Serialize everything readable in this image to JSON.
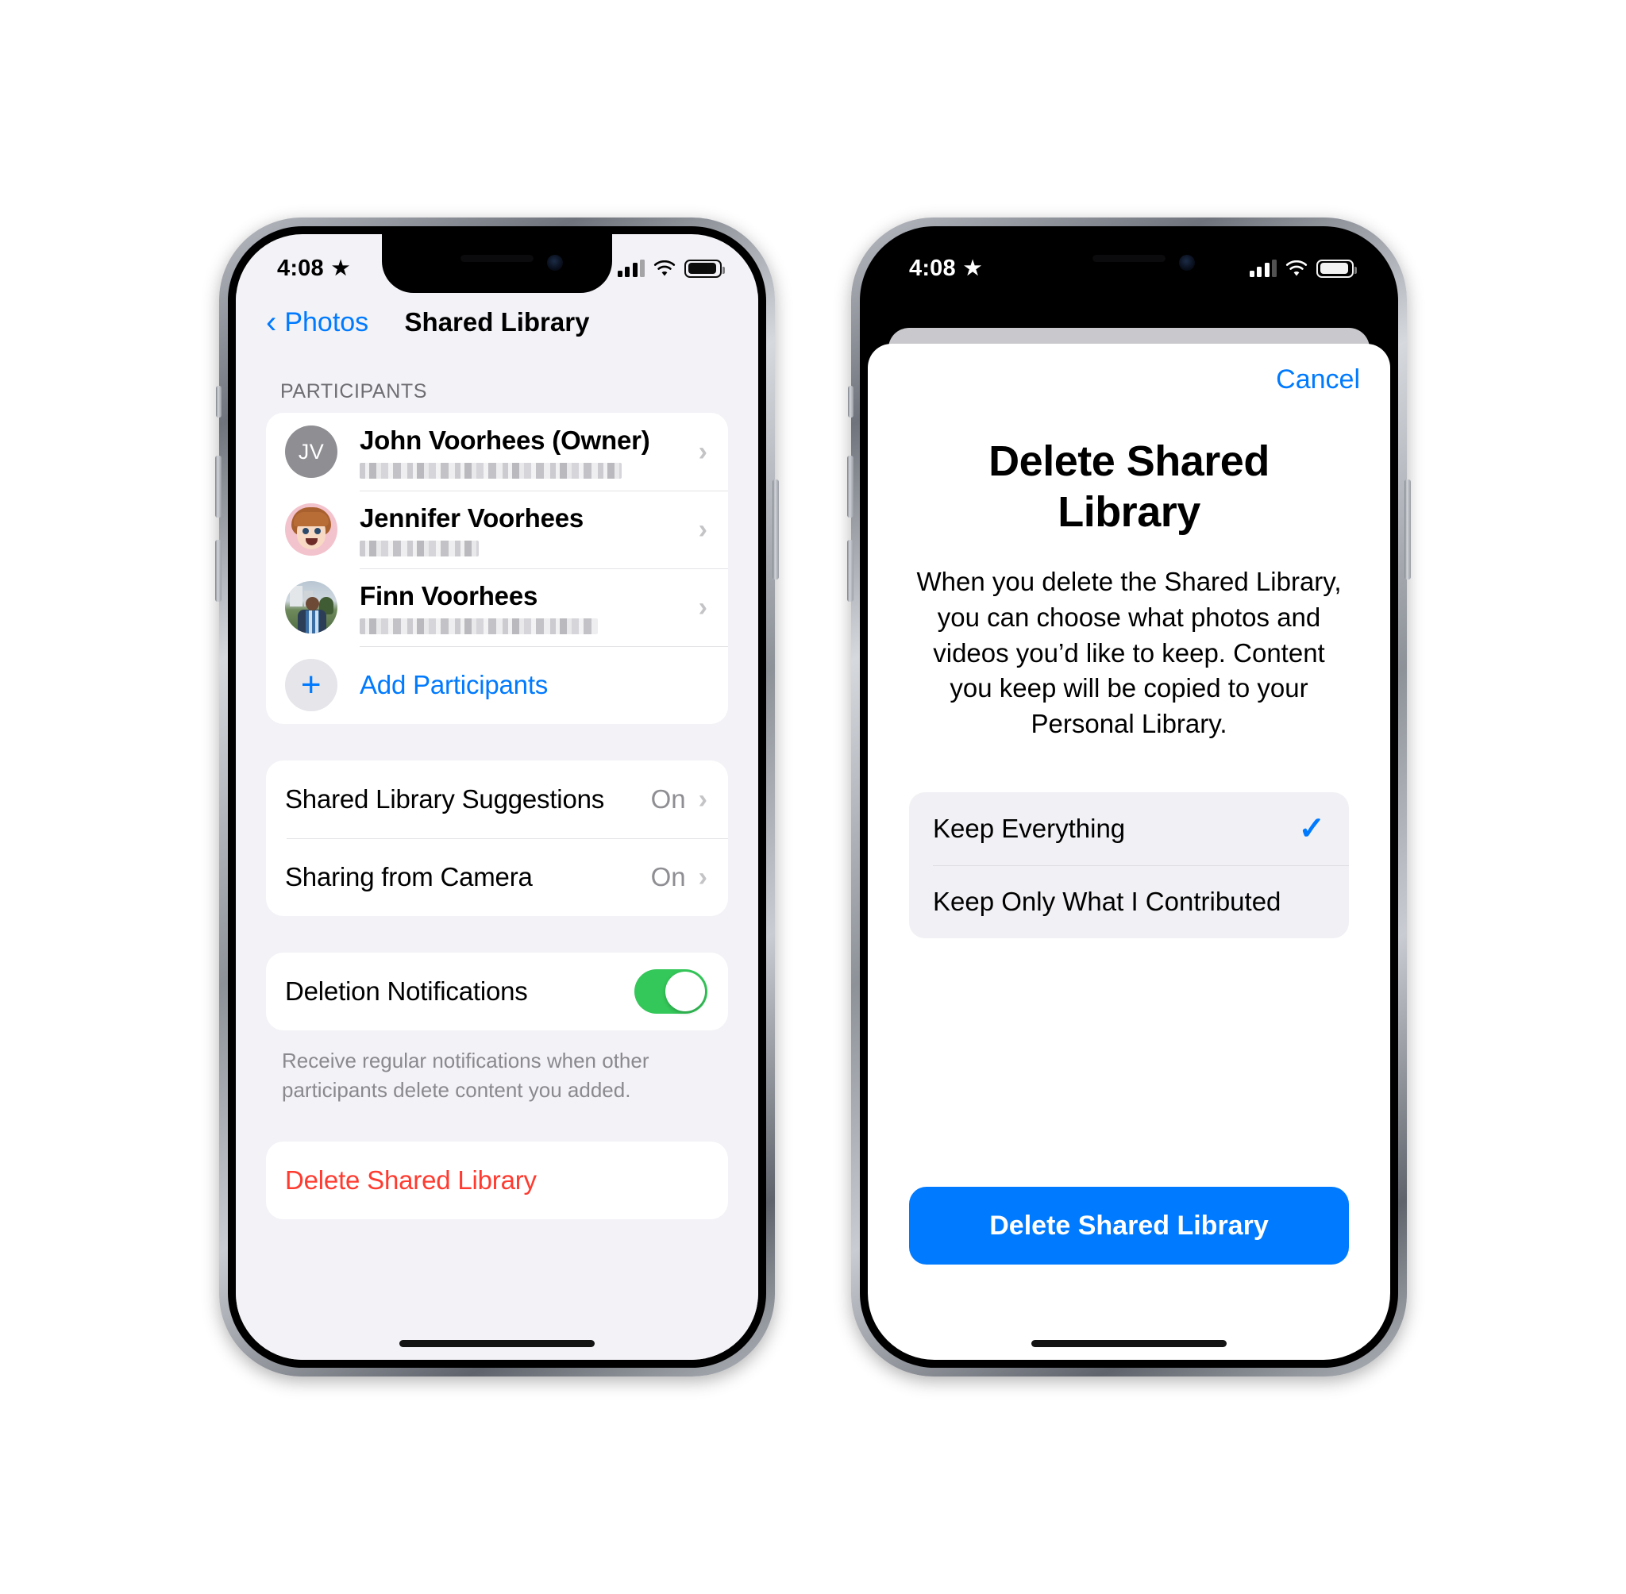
{
  "left_phone": {
    "status_bar": {
      "time": "4:08",
      "star_icon": "star-icon",
      "cellular_icon": "cellular-bars-icon",
      "wifi_icon": "wifi-icon",
      "battery_icon": "battery-icon"
    },
    "nav": {
      "back_label": "Photos",
      "title": "Shared Library"
    },
    "participants": {
      "header": "PARTICIPANTS",
      "items": [
        {
          "name": "John Voorhees (Owner)",
          "initials": "JV",
          "subtitle_redacted": true,
          "avatar_kind": "initials"
        },
        {
          "name": "Jennifer Voorhees",
          "initials": "",
          "subtitle_redacted": true,
          "avatar_kind": "memoji"
        },
        {
          "name": "Finn Voorhees",
          "initials": "",
          "subtitle_redacted": true,
          "avatar_kind": "photo"
        }
      ],
      "add_label": "Add Participants",
      "add_icon": "plus-icon"
    },
    "settings": [
      {
        "label": "Shared Library Suggestions",
        "value": "On"
      },
      {
        "label": "Sharing from Camera",
        "value": "On"
      }
    ],
    "deletion": {
      "label": "Deletion Notifications",
      "toggle_on": true,
      "toggle_color": "#34c759",
      "footnote": "Receive regular notifications when other participants delete content you added."
    },
    "destructive": {
      "label": "Delete Shared Library",
      "color": "#ff3b30"
    }
  },
  "right_phone": {
    "status_bar": {
      "time": "4:08",
      "star_icon": "star-icon",
      "cellular_icon": "cellular-bars-icon",
      "wifi_icon": "wifi-icon",
      "battery_icon": "battery-icon"
    },
    "sheet": {
      "cancel_label": "Cancel",
      "title": "Delete Shared Library",
      "description": "When you delete the Shared Library, you can choose what photos and videos you’d like to keep. Content you keep will be copied to your Personal Library.",
      "options": [
        {
          "label": "Keep Everything",
          "selected": true,
          "check_icon": "checkmark-icon"
        },
        {
          "label": "Keep Only What I Contributed",
          "selected": false,
          "check_icon": ""
        }
      ],
      "primary_button": {
        "label": "Delete Shared Library",
        "color": "#007aff"
      }
    }
  },
  "colors": {
    "accent_blue": "#007aff",
    "destructive_red": "#ff3b30",
    "toggle_green": "#34c759",
    "grouped_bg": "#f2f2f7"
  }
}
